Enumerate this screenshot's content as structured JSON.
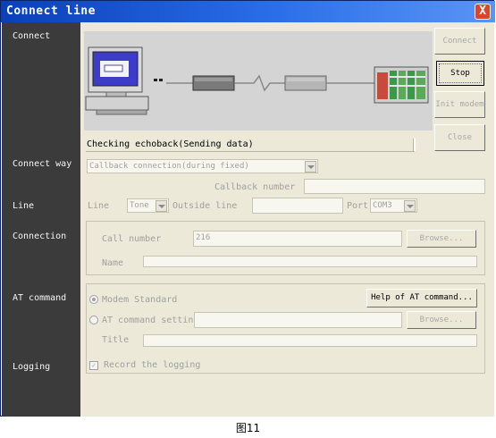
{
  "window": {
    "title": "Connect line",
    "close_glyph": "X"
  },
  "sidebar": {
    "connect": "Connect",
    "connect_way": "Connect way",
    "line": "Line",
    "connection": "Connection",
    "at_command": "AT command",
    "logging": "Logging"
  },
  "status": {
    "text": "Checking echoback(Sending data)"
  },
  "buttons": {
    "connect": "Connect",
    "stop": "Stop",
    "init_modem": "Init modem",
    "close": "Close",
    "browse_call": "Browse...",
    "help_at": "Help of AT command...",
    "browse_at": "Browse..."
  },
  "connect_way": {
    "selected": "Callback connection(during fixed)",
    "callback_number_label": "Callback number",
    "callback_number_value": ""
  },
  "line": {
    "line_label": "Line",
    "line_type": "Tone",
    "outside_line_label": "Outside line",
    "outside_line_value": "",
    "port_label": "Port",
    "port_value": "COM3"
  },
  "connection": {
    "call_number_label": "Call number",
    "call_number_value": "216",
    "name_label": "Name",
    "name_value": ""
  },
  "at_command": {
    "modem_standard_label": "Modem Standard",
    "modem_standard_selected": true,
    "at_setting_label": "AT command setting",
    "at_setting_value": "",
    "title_label": "Title",
    "title_value": ""
  },
  "logging": {
    "record_label": "Record the logging",
    "record_checked": true
  },
  "caption": "图11",
  "colors": {
    "titlebar": "#0a3fb8",
    "sidebar": "#3b3b3b",
    "panel": "#ece9d8"
  },
  "icons": {
    "close": "close-icon",
    "diagram": "connection-diagram"
  }
}
